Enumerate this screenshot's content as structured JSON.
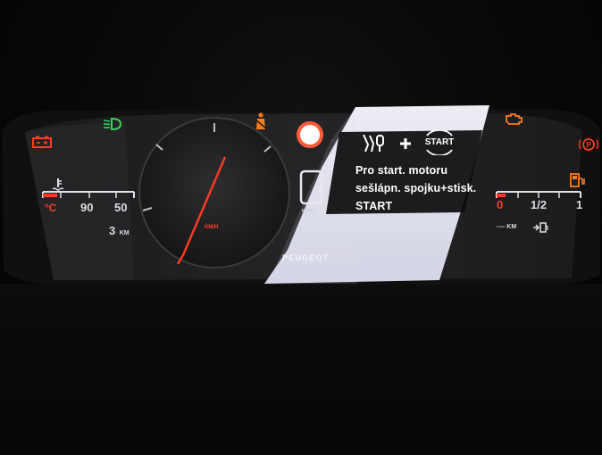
{
  "colors": {
    "warning_red": "#ff3b22",
    "warning_orange": "#ff7a1a",
    "indicator_green": "#39d35a",
    "text_white": "#f2f2f6",
    "panel_glow": "#e9eaf6"
  },
  "icons": {
    "battery": "battery-warning-icon",
    "headlights": "low-beam-headlight-icon",
    "seatbelt": "seatbelt-warning-icon",
    "engine": "check-engine-icon",
    "parking_brake": "parking-brake-icon",
    "fuel": "fuel-pump-icon",
    "coolant": "coolant-temperature-icon",
    "clutch_pedal": "clutch-pedal-icon",
    "start_button": "start-button-icon"
  },
  "temperature": {
    "unit": "°C",
    "label_90": "90",
    "label_50": "50"
  },
  "trip": {
    "value": "3",
    "unit": "KM"
  },
  "speedometer": {
    "unit": "KM/H"
  },
  "gear": {
    "unit": "KM/H"
  },
  "message": {
    "start_label": "START",
    "line1": "Pro start. motoru",
    "line2": "sešlápn. spojku+stisk.",
    "line3": "START"
  },
  "fuel": {
    "label_0": "0",
    "label_half": "1/2",
    "label_full": "1",
    "range": "---- KM"
  },
  "brand": {
    "name": "PEUGEOT"
  }
}
